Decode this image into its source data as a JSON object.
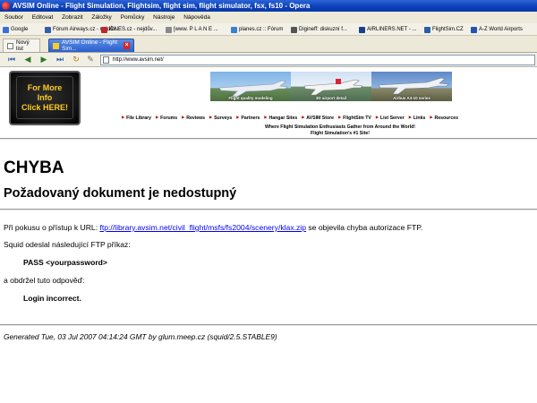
{
  "window": {
    "title": "AVSIM Online - Flight Simulation, Flightsim, flight sim, flight simulator, fsx, fs10 - Opera"
  },
  "menu": [
    "Soubor",
    "Editovat",
    "Zobrazit",
    "Záložky",
    "Pomůcky",
    "Nástroje",
    "Nápověda"
  ],
  "bookmarks": [
    {
      "label": "Google",
      "color": "#3a6fd8"
    },
    {
      "label": "Fórum Airways.cz - nejdův...",
      "color": "#2f5fae"
    },
    {
      "label": "iDNES.cz - nejdův...",
      "color": "#c0282d"
    },
    {
      "label": "[www. P L A N E ...",
      "color": "#8a8a8a"
    },
    {
      "label": "planes.cz :: Fórum",
      "color": "#3c7fcf"
    },
    {
      "label": "Digineff: diskuzní f...",
      "color": "#555555"
    },
    {
      "label": "AIRLINERS.NET - ...",
      "color": "#1b3f8a"
    },
    {
      "label": "FlightSim.CZ",
      "color": "#2a5fa8"
    },
    {
      "label": "A-Z World Airports",
      "color": "#2053b5"
    }
  ],
  "tabs": {
    "new_list": "Nový list",
    "active": "AVSIM Online - Flight Sim..."
  },
  "address_bar": {
    "url": "http://www.avsim.net/"
  },
  "ad": {
    "lines": [
      "For More",
      "Info",
      "Click HERE!"
    ]
  },
  "banners": [
    "Flight quality modeling",
    "3D airport detail",
    "Airbus A3-10 series"
  ],
  "site_nav": [
    "File Library",
    "Forums",
    "Reviews",
    "Surveys",
    "Partners",
    "Hangar Sites",
    "AVSIM Store",
    "FlightSim TV",
    "List Server",
    "Links",
    "Resources"
  ],
  "tagline": {
    "line1": "Where Flight Simulation Enthusiasts Gather from Around the World!",
    "line2": "Flight Simulation's #1 Site!"
  },
  "error": {
    "heading": "CHYBA",
    "subheading": "Požadovaný dokument je nedostupný",
    "para1_before": "Při pokusu o přístup k URL: ",
    "para1_link": "ftp://library.avsim.net/civil_flight/msfs/fs2004/scenery/klax.zip",
    "para1_after": " se objevila chyba autorizace FTP.",
    "para2": "Squid odeslal následující FTP příkaz:",
    "command": "PASS <yourpassword>",
    "para3": "a obdržel tuto odpověď:",
    "response": "Login incorrect.",
    "footer": "Generated Tue, 03 Jul 2007 04:14:24 GMT by glum.meep.cz (squid/2.5.STABLE9)"
  }
}
